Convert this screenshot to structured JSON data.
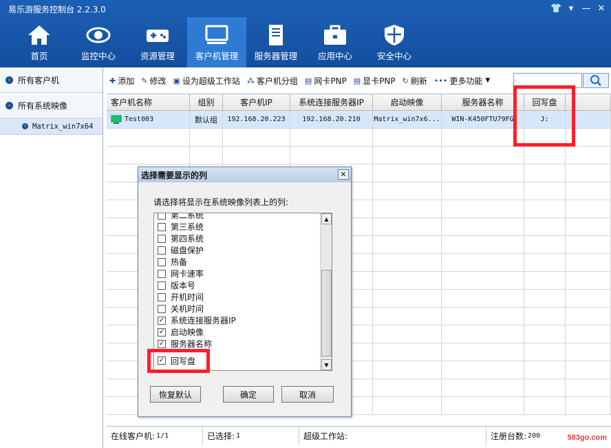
{
  "app": {
    "title": "易乐游服务控制台 2.2.3.0"
  },
  "window_controls": {
    "skin": "👕",
    "menu": "▾",
    "minimize": "—",
    "close": "✕"
  },
  "nav": [
    {
      "label": "首页",
      "icon": "home-icon"
    },
    {
      "label": "监控中心",
      "icon": "eye-icon"
    },
    {
      "label": "资源管理",
      "icon": "gamepad-icon"
    },
    {
      "label": "客户机管理",
      "icon": "monitor-icon",
      "active": true
    },
    {
      "label": "服务器管理",
      "icon": "server-icon"
    },
    {
      "label": "应用中心",
      "icon": "toolbox-icon"
    },
    {
      "label": "安全中心",
      "icon": "shield-icon"
    }
  ],
  "sidebar": {
    "group1": "所有客户机",
    "group2": "所有系统映像",
    "sub1": "Matrix_win7x64"
  },
  "toolbar": {
    "add": "添加",
    "edit": "修改",
    "set_super": "设为超级工作站",
    "group": "客户机分组",
    "nic_pnp": "网卡PNP",
    "gpu_pnp": "显卡PNP",
    "refresh": "刷新",
    "more": "更多功能"
  },
  "search": {
    "value": ""
  },
  "table": {
    "headers": [
      "客户机名称",
      "组别",
      "客户机IP",
      "系统连接服务器IP",
      "启动映像",
      "服务器名称",
      "回写盘"
    ],
    "row": [
      "Test003",
      "默认组",
      "192.168.20.223",
      "192.168.20.210",
      "Matrix_win7x6...",
      "WIN-K450FTU79FG",
      "J:"
    ]
  },
  "status": {
    "online_label": "在线客户机:",
    "online_value": "1/1",
    "selected_label": "已选择:",
    "selected_value": "1",
    "super_label": "超级工作站:",
    "super_value": "",
    "registered_label": "注册台数:",
    "registered_value": "200"
  },
  "watermark": "583go.com",
  "dialog": {
    "title": "选择需要显示的列",
    "prompt": "请选择将显示在系统映像列表上的列:",
    "items": [
      {
        "label": "第二系统",
        "checked": false
      },
      {
        "label": "第三系统",
        "checked": false
      },
      {
        "label": "第四系统",
        "checked": false
      },
      {
        "label": "磁盘保护",
        "checked": false
      },
      {
        "label": "热备",
        "checked": false
      },
      {
        "label": "网卡速率",
        "checked": false
      },
      {
        "label": "版本号",
        "checked": false
      },
      {
        "label": "开机时间",
        "checked": false
      },
      {
        "label": "关机时间",
        "checked": false
      },
      {
        "label": "系统连接服务器IP",
        "checked": true
      },
      {
        "label": "启动映像",
        "checked": true
      },
      {
        "label": "服务器名称",
        "checked": true
      },
      {
        "label": "回写盘",
        "checked": true
      }
    ],
    "buttons": {
      "restore": "恢复默认",
      "ok": "确定",
      "cancel": "取消"
    }
  },
  "colors": {
    "header_bg": "#1b58ab",
    "active_nav": "#2f7bd4",
    "highlight": "#ff1e2a",
    "row_selected": "#d7e7fb"
  }
}
